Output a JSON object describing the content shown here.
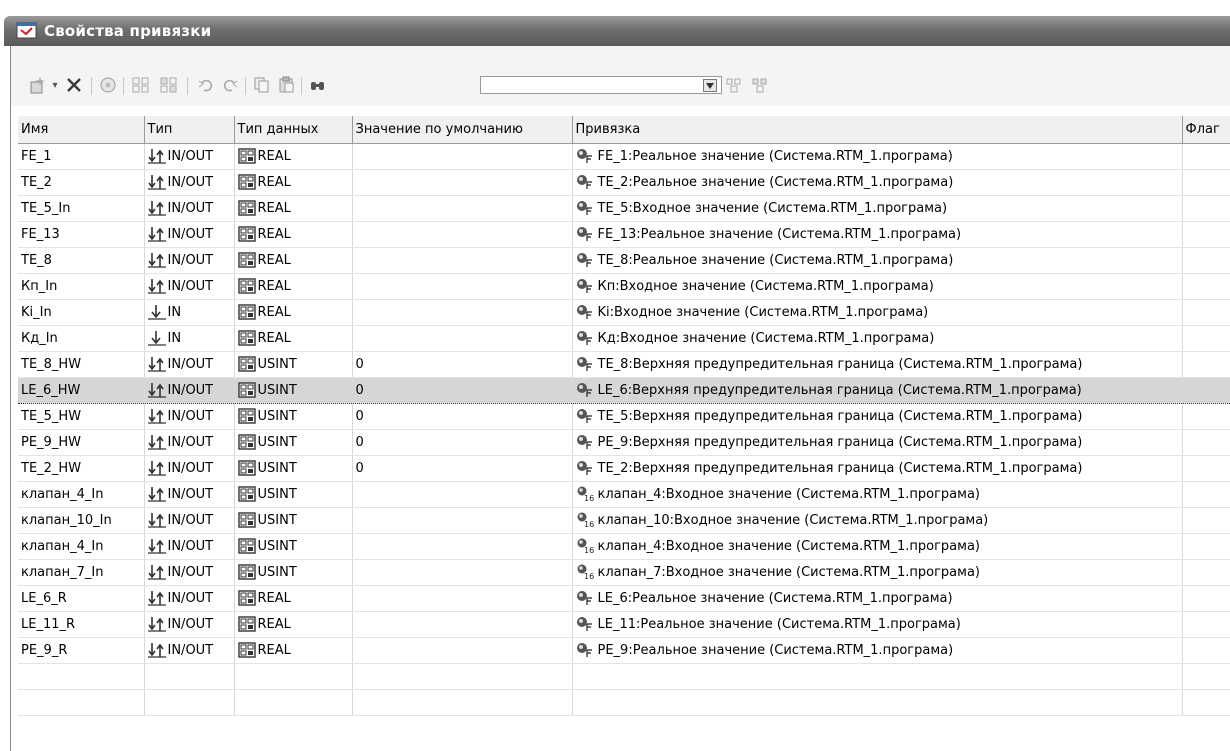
{
  "window": {
    "title": "Свойства привязки"
  },
  "toolbar": {
    "search_value": "",
    "icons": [
      "new-item-icon",
      "dropdown-arrow-icon",
      "delete-icon",
      "properties-icon",
      "grid-icon",
      "grid-alt-icon",
      "undo-icon",
      "redo-icon",
      "copy-icon",
      "paste-icon",
      "find-icon",
      "combo-dropdown-icon",
      "filter-icon",
      "filter-alt-icon"
    ]
  },
  "table": {
    "columns": [
      "Имя",
      "Тип",
      "Тип данных",
      "Значение по умолчанию",
      "Привязка",
      "Флаг"
    ],
    "rows": [
      {
        "name": "FE_1",
        "type": "IN/OUT",
        "dtype": "REAL",
        "default": "",
        "binding": "FE_1:Реальное значение (Система.RTM_1.програма)",
        "bind_icon": "F",
        "selected": false
      },
      {
        "name": "TE_2",
        "type": "IN/OUT",
        "dtype": "REAL",
        "default": "",
        "binding": "TE_2:Реальное значение (Система.RTM_1.програма)",
        "bind_icon": "F",
        "selected": false
      },
      {
        "name": "TE_5_In",
        "type": "IN/OUT",
        "dtype": "REAL",
        "default": "",
        "binding": "TE_5:Входное значение (Система.RTM_1.програма)",
        "bind_icon": "F",
        "selected": false
      },
      {
        "name": "FE_13",
        "type": "IN/OUT",
        "dtype": "REAL",
        "default": "",
        "binding": "FE_13:Реальное значение (Система.RTM_1.програма)",
        "bind_icon": "F",
        "selected": false
      },
      {
        "name": "TE_8",
        "type": "IN/OUT",
        "dtype": "REAL",
        "default": "",
        "binding": "TE_8:Реальное значение (Система.RTM_1.програма)",
        "bind_icon": "F",
        "selected": false
      },
      {
        "name": "Кп_In",
        "type": "IN/OUT",
        "dtype": "REAL",
        "default": "",
        "binding": "Кп:Входное значение (Система.RTM_1.програма)",
        "bind_icon": "F",
        "selected": false
      },
      {
        "name": "Ki_In",
        "type": "IN",
        "dtype": "REAL",
        "default": "",
        "binding": "Ki:Входное значение (Система.RTM_1.програма)",
        "bind_icon": "F",
        "selected": false
      },
      {
        "name": "Кд_In",
        "type": "IN",
        "dtype": "REAL",
        "default": "",
        "binding": "Кд:Входное значение (Система.RTM_1.програма)",
        "bind_icon": "F",
        "selected": false
      },
      {
        "name": "TE_8_HW",
        "type": "IN/OUT",
        "dtype": "USINT",
        "default": "0",
        "binding": "TE_8:Верхняя предупредительная граница (Система.RTM_1.програма)",
        "bind_icon": "F",
        "selected": false
      },
      {
        "name": "LE_6_HW",
        "type": "IN/OUT",
        "dtype": "USINT",
        "default": "0",
        "binding": "LE_6:Верхняя предупредительная граница (Система.RTM_1.програма)",
        "bind_icon": "F",
        "selected": true
      },
      {
        "name": "TE_5_HW",
        "type": "IN/OUT",
        "dtype": "USINT",
        "default": "0",
        "binding": "TE_5:Верхняя предупредительная граница (Система.RTM_1.програма)",
        "bind_icon": "F",
        "selected": false
      },
      {
        "name": "PE_9_HW",
        "type": "IN/OUT",
        "dtype": "USINT",
        "default": "0",
        "binding": "PE_9:Верхняя предупредительная граница (Система.RTM_1.програма)",
        "bind_icon": "F",
        "selected": false
      },
      {
        "name": "TE_2_HW",
        "type": "IN/OUT",
        "dtype": "USINT",
        "default": "0",
        "binding": "TE_2:Верхняя предупредительная граница (Система.RTM_1.програма)",
        "bind_icon": "F",
        "selected": false
      },
      {
        "name": "клапан_4_In",
        "type": "IN/OUT",
        "dtype": "USINT",
        "default": "",
        "binding": "клапан_4:Входное значение (Система.RTM_1.програма)",
        "bind_icon": "16",
        "selected": false
      },
      {
        "name": "клапан_10_In",
        "type": "IN/OUT",
        "dtype": "USINT",
        "default": "",
        "binding": "клапан_10:Входное значение (Система.RTM_1.програма)",
        "bind_icon": "16",
        "selected": false
      },
      {
        "name": "клапан_4_In",
        "type": "IN/OUT",
        "dtype": "USINT",
        "default": "",
        "binding": "клапан_4:Входное значение (Система.RTM_1.програма)",
        "bind_icon": "16",
        "selected": false
      },
      {
        "name": "клапан_7_In",
        "type": "IN/OUT",
        "dtype": "USINT",
        "default": "",
        "binding": "клапан_7:Входное значение (Система.RTM_1.програма)",
        "bind_icon": "16",
        "selected": false
      },
      {
        "name": "LE_6_R",
        "type": "IN/OUT",
        "dtype": "REAL",
        "default": "",
        "binding": "LE_6:Реальное значение (Система.RTM_1.програма)",
        "bind_icon": "F",
        "selected": false
      },
      {
        "name": "LE_11_R",
        "type": "IN/OUT",
        "dtype": "REAL",
        "default": "",
        "binding": "LE_11:Реальное значение (Система.RTM_1.програма)",
        "bind_icon": "F",
        "selected": false
      },
      {
        "name": "PE_9_R",
        "type": "IN/OUT",
        "dtype": "REAL",
        "default": "",
        "binding": "PE_9:Реальное значение (Система.RTM_1.програма)",
        "bind_icon": "F",
        "selected": false
      }
    ]
  }
}
